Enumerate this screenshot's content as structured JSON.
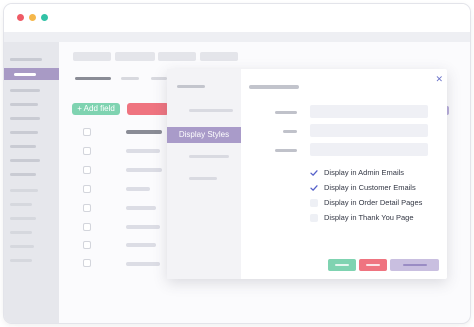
{
  "window": {
    "traffic_lights": [
      "#ef5b66",
      "#f5b74a",
      "#32c2a6"
    ]
  },
  "toolbar": {
    "add_field_label": "+ Add field"
  },
  "modal": {
    "active_tab_label": "Display Styles",
    "options": [
      {
        "label": "Display in Admin Emails",
        "checked": true
      },
      {
        "label": "Display in Customer Emails",
        "checked": true
      },
      {
        "label": "Display in Order Detail Pages",
        "checked": false
      },
      {
        "label": "Display in Thank You Page",
        "checked": false
      }
    ],
    "close_icon": "close-icon",
    "colors": {
      "accent": "#a99bc9",
      "save": "#7fd3b1",
      "delete": "#ef7480",
      "secondary": "#c9bfe0"
    }
  }
}
